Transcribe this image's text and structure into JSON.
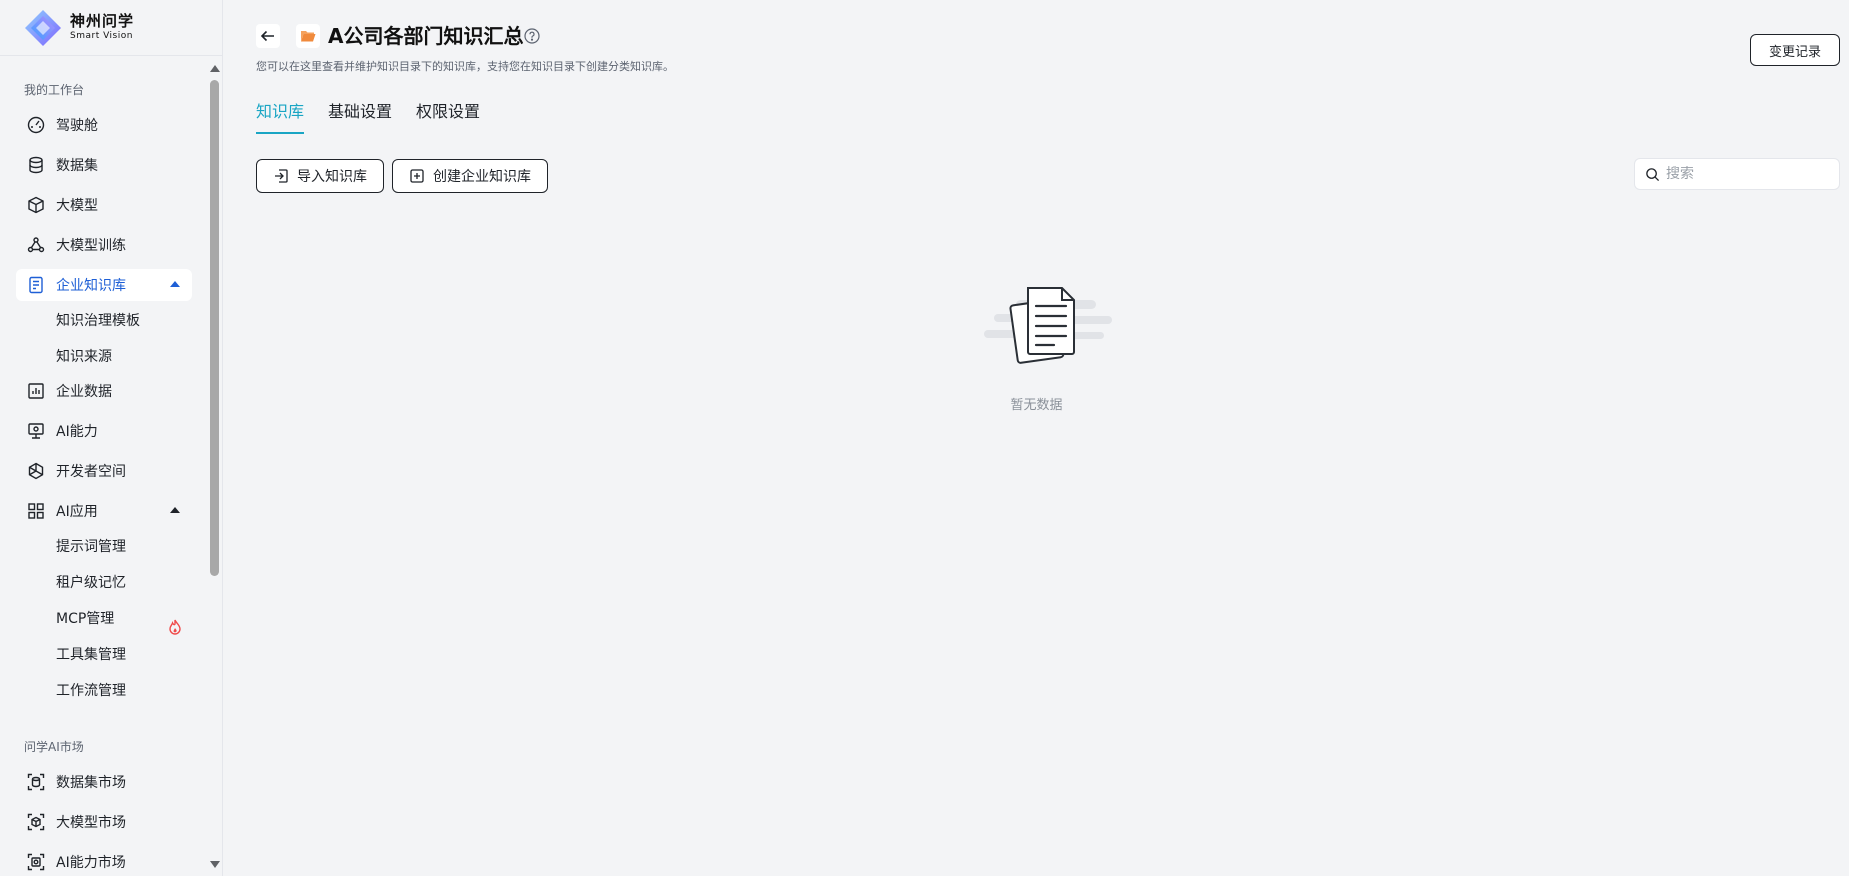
{
  "brand": {
    "name_cn": "神州问学",
    "name_en": "Smart Vision"
  },
  "sidebar": {
    "group1_title": "我的工作台",
    "items": [
      {
        "label": "驾驶舱",
        "icon": "dashboard-icon"
      },
      {
        "label": "数据集",
        "icon": "database-icon"
      },
      {
        "label": "大模型",
        "icon": "cube-icon"
      },
      {
        "label": "大模型训练",
        "icon": "training-icon"
      },
      {
        "label": "企业知识库",
        "icon": "knowledge-book-icon",
        "active": true,
        "expanded": true
      },
      {
        "label": "知识治理模板",
        "sub": true
      },
      {
        "label": "知识来源",
        "sub": true
      },
      {
        "label": "企业数据",
        "icon": "bar-chart-icon"
      },
      {
        "label": "AI能力",
        "icon": "ai-screen-icon"
      },
      {
        "label": "开发者空间",
        "icon": "developer-hex-icon"
      },
      {
        "label": "AI应用",
        "icon": "apps-grid-icon",
        "expanded": true
      },
      {
        "label": "提示词管理",
        "sub": true
      },
      {
        "label": "租户级记忆",
        "sub": true
      },
      {
        "label": "MCP管理",
        "sub": true,
        "badge": "fire-icon"
      },
      {
        "label": "工具集管理",
        "sub": true
      },
      {
        "label": "工作流管理",
        "sub": true
      }
    ],
    "group2_title": "问学AI市场",
    "market_items": [
      {
        "label": "数据集市场",
        "icon": "dataset-market-icon"
      },
      {
        "label": "大模型市场",
        "icon": "model-market-icon"
      },
      {
        "label": "AI能力市场",
        "icon": "ai-market-icon"
      }
    ]
  },
  "header": {
    "title": "A公司各部门知识汇总",
    "subtitle": "您可以在这里查看并维护知识目录下的知识库，支持您在知识目录下创建分类知识库。",
    "change_log_label": "变更记录"
  },
  "tabs": [
    {
      "label": "知识库",
      "active": true
    },
    {
      "label": "基础设置"
    },
    {
      "label": "权限设置"
    }
  ],
  "toolbar": {
    "import_label": "导入知识库",
    "create_label": "创建企业知识库",
    "search_placeholder": "搜索"
  },
  "empty": {
    "text": "暂无数据"
  },
  "colors": {
    "accent": "#19a5c4",
    "active_nav": "#1e5fd6",
    "folder": "#f08a3c",
    "fire": "#f04a4a"
  }
}
